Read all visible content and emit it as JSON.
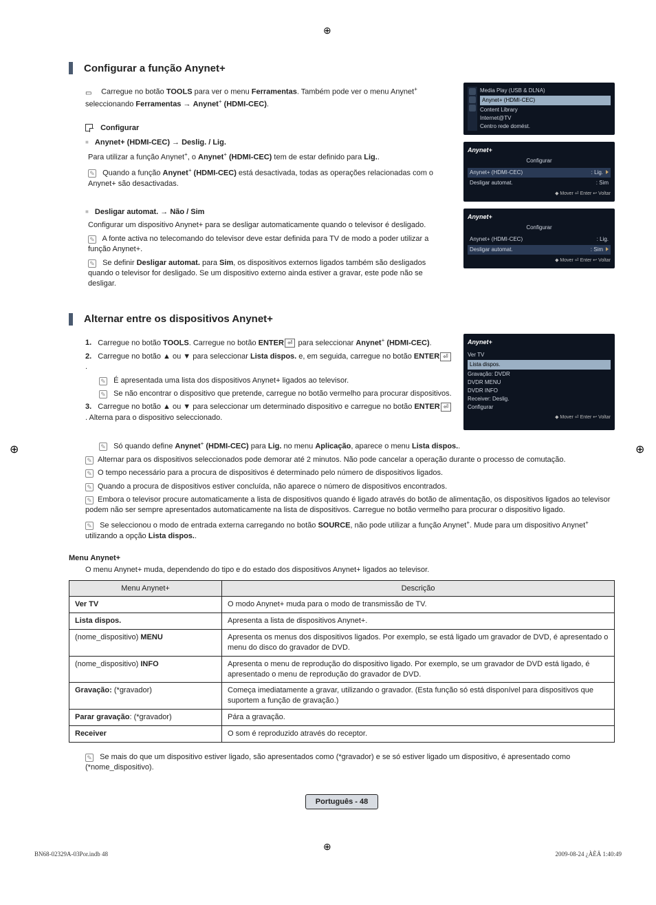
{
  "crosshair_glyph": "⊕",
  "section1": {
    "title": "Configurar a função Anynet+",
    "intro_part1": "Carregue no botão ",
    "intro_tools": "TOOLS",
    "intro_part2": " para ver o menu ",
    "intro_ferr": "Ferramentas",
    "intro_part3": ". Também pode ver o menu Anynet",
    "intro_part4": " seleccionando ",
    "intro_ferr2": "Ferramentas",
    "intro_arrow": " → ",
    "intro_anynet": "Anynet",
    "intro_hdmi": " (HDMI-CEC)",
    "intro_dot": ".",
    "config_head": "Configurar",
    "item1_bold": "Anynet+ (HDMI-CEC) → Deslig. / Lig.",
    "item1_line1_a": "Para utilizar a função Anynet",
    "item1_line1_b": ", o ",
    "item1_line1_c": "Anynet",
    "item1_line1_d": " (HDMI-CEC)",
    "item1_line1_e": " tem de estar definido para ",
    "item1_line1_f": "Lig.",
    "item1_line1_g": ".",
    "item1_note_a": "Quando a função ",
    "item1_note_b": "Anynet",
    "item1_note_c": " (HDMI-CEC)",
    "item1_note_d": " está desactivada, todas as operações relacionadas com o Anynet+ são desactivadas.",
    "item2_bold": "Desligar automat. → Não / Sim",
    "item2_line1": "Configurar um dispositivo Anynet+ para se desligar automaticamente quando o televisor é desligado.",
    "item2_note1": "A fonte activa no telecomando do televisor deve estar definida para TV de modo a poder utilizar a função Anynet+.",
    "item2_note2_a": "Se definir ",
    "item2_note2_b": "Desligar automat.",
    "item2_note2_c": " para ",
    "item2_note2_d": "Sim",
    "item2_note2_e": ", os dispositivos externos ligados também são desligados quando o televisor for desligado. Se um dispositivo externo ainda estiver a gravar, este pode não se desligar."
  },
  "osd1": {
    "line1": "Media Play (USB & DLNA)",
    "line2": "Anynet+ (HDMI-CEC)",
    "line3": "Content Library",
    "line4": "Internet@TV",
    "line5": "Centro rede domést."
  },
  "osd2": {
    "brand": "Anynet+",
    "head": "Configurar",
    "r1a": "Anynet+ (HDMI-CEC)",
    "r1b": ": Lig.",
    "r2a": "Desligar automat.",
    "r2b": ": Sim",
    "foot": "◆ Mover   ⏎ Enter   ↩ Voltar"
  },
  "osd3": {
    "brand": "Anynet+",
    "head": "Configurar",
    "r1a": "Anynet+ (HDMI-CEC)",
    "r1b": ": Lig.",
    "r2a": "Desligar automat.",
    "r2b": ": Sim",
    "foot": "◆ Mover   ⏎ Enter   ↩ Voltar"
  },
  "section2": {
    "title": "Alternar entre os dispositivos Anynet+",
    "s1_a": "Carregue no botão ",
    "s1_b": "TOOLS",
    "s1_c": ". Carregue no botão ",
    "s1_d": "ENTER",
    "s1_e": " para seleccionar ",
    "s1_f": "Anynet",
    "s1_g": " (HDMI-CEC)",
    "s1_h": ".",
    "s2_a": "Carregue no botão ▲ ou ▼ para seleccionar ",
    "s2_b": "Lista dispos.",
    "s2_c": " e, em seguida, carregue no botão ",
    "s2_d": "ENTER",
    "s2_e": ".",
    "s2_n1": "É apresentada uma lista dos dispositivos Anynet+ ligados ao televisor.",
    "s2_n2": "Se não encontrar o dispositivo que pretende, carregue no botão vermelho para procurar dispositivos.",
    "s3_a": "Carregue no botão ▲ ou ▼ para seleccionar um determinado dispositivo e carregue no botão ",
    "s3_b": "ENTER",
    "s3_c": ". Alterna para o dispositivo seleccionado.",
    "s3_n1_a": "Só quando define ",
    "s3_n1_b": "Anynet",
    "s3_n1_c": " (HDMI-CEC)",
    "s3_n1_d": " para ",
    "s3_n1_e": "Lig.",
    "s3_n1_f": " no menu ",
    "s3_n1_g": "Aplicação",
    "s3_n1_h": ", aparece o menu ",
    "s3_n1_i": "Lista dispos.",
    "s3_n1_j": ".",
    "bn1": "Alternar para os dispositivos seleccionados pode demorar até 2 minutos. Não pode cancelar a operação durante o processo de comutação.",
    "bn2": "O tempo necessário para a procura de dispositivos é determinado pelo número de dispositivos ligados.",
    "bn3": "Quando a procura de dispositivos estiver concluída, não aparece o número de dispositivos encontrados.",
    "bn4": "Embora o televisor procure automaticamente a lista de dispositivos quando é ligado através do botão de alimentação, os dispositivos ligados ao televisor podem não ser sempre apresentados automaticamente na lista de dispositivos. Carregue no botão vermelho para procurar o dispositivo ligado.",
    "bn5_a": "Se seleccionou o modo de entrada externa carregando no botão ",
    "bn5_b": "SOURCE",
    "bn5_c": ", não pode utilizar a função Anynet",
    "bn5_d": ". Mude para um dispositivo Anynet",
    "bn5_e": " utilizando a opção ",
    "bn5_f": "Lista dispos.",
    "bn5_g": "."
  },
  "osd4": {
    "brand": "Anynet+",
    "i1": "Ver TV",
    "i2": "Lista dispos.",
    "i3": "Gravação: DVDR",
    "i4": "DVDR MENU",
    "i5": "DVDR INFO",
    "i6": "Receiver: Deslig.",
    "i7": "Configurar",
    "foot": "◆ Mover   ⏎ Enter   ↩ Voltar"
  },
  "menu": {
    "heading": "Menu Anynet+",
    "intro": "O menu Anynet+ muda, dependendo do tipo e do estado dos dispositivos Anynet+ ligados ao televisor.",
    "h1": "Menu Anynet+",
    "h2": "Descrição",
    "r1a": "Ver TV",
    "r1b": "O modo Anynet+ muda para o modo de transmissão de TV.",
    "r2a": "Lista dispos.",
    "r2b": "Apresenta a lista de dispositivos Anynet+.",
    "r3a_a": "(nome_dispositivo) ",
    "r3a_b": "MENU",
    "r3b": "Apresenta os menus dos dispositivos ligados. Por exemplo, se está ligado um gravador de DVD, é apresentado o menu do disco do gravador de DVD.",
    "r4a_a": "(nome_dispositivo) ",
    "r4a_b": "INFO",
    "r4b": "Apresenta o menu de reprodução do dispositivo ligado. Por exemplo, se um gravador de DVD está ligado, é apresentado o menu de reprodução do gravador de DVD.",
    "r5a_a": "Gravação:",
    "r5a_b": " (*gravador)",
    "r5b": "Começa imediatamente a gravar, utilizando o gravador. (Esta função só está disponível para dispositivos que suportem a função de gravação.)",
    "r6a_a": "Parar gravação",
    "r6a_b": ": (*gravador)",
    "r6b": "Pára a gravação.",
    "r7a": "Receiver",
    "r7b": "O som é reproduzido através do receptor.",
    "endnote": "Se mais do que um dispositivo estiver ligado, são apresentados como (*gravador) e se só estiver ligado um dispositivo, é apresentado como (*nome_dispositivo)."
  },
  "footer": {
    "page": "Português - 48",
    "left": "BN68-02329A-03Por.indb   48",
    "right": "2009-08-24   ¿ÀÈÄ 1:40:49"
  }
}
